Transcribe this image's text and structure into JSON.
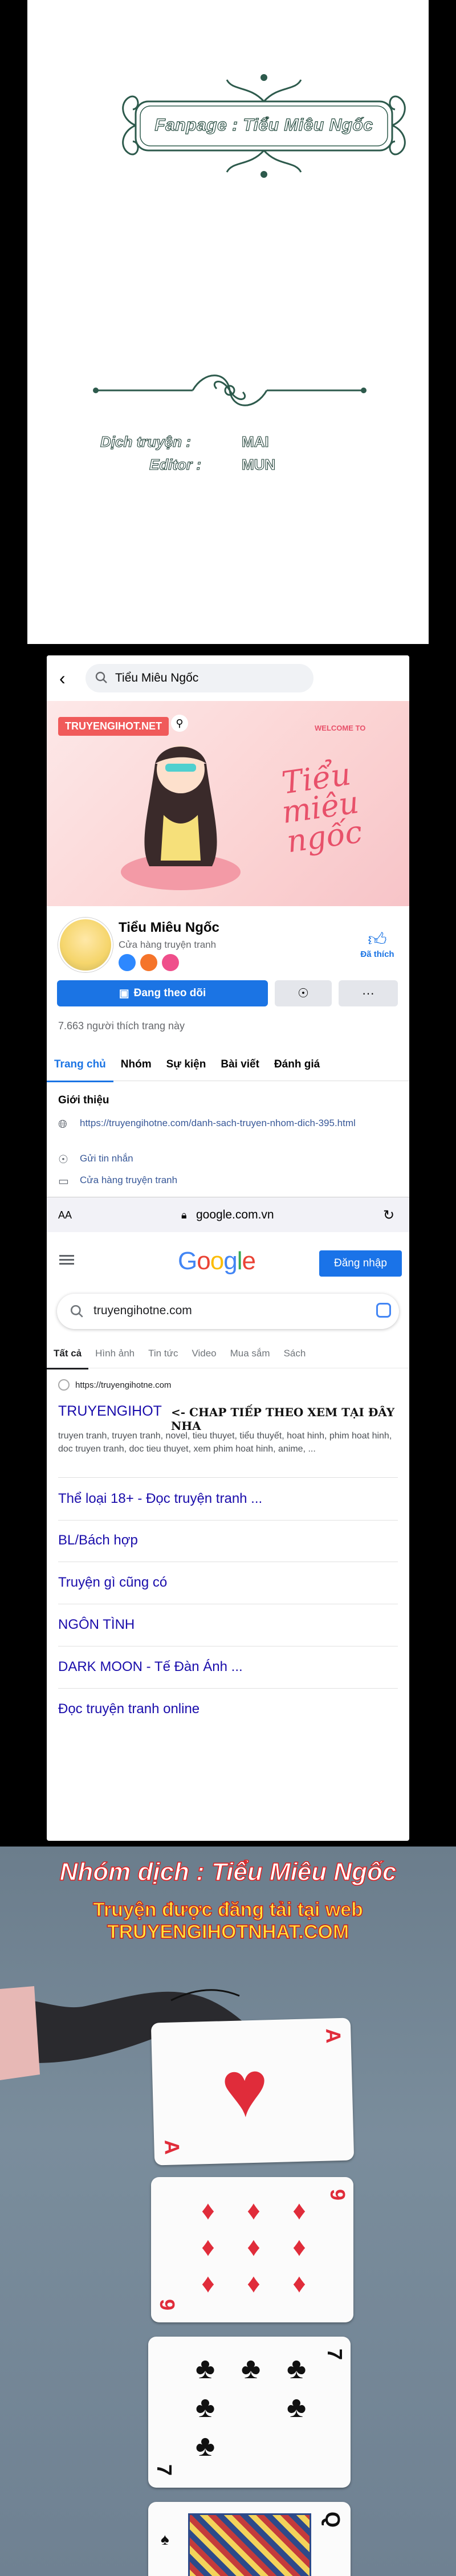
{
  "credits": {
    "fanpage": "Fanpage : Tiểu Miêu Ngốc",
    "translator_label": "Dịch truyện :",
    "translator_value": "MAI",
    "editor_label": "Editor :",
    "editor_value": "MUN"
  },
  "facebook": {
    "search_text": "Tiểu Miêu Ngốc",
    "cover_badge": "TRUYENGIHOT.NET",
    "cover_welcome": "WELCOME TO",
    "cover_title": "Tiểu miêu ngốc",
    "page_name": "Tiểu Miêu Ngốc",
    "page_category": "Cửa hàng truyện tranh",
    "like_label": "Đã thích",
    "follow_label": "Đang theo dõi",
    "more_label": "···",
    "likes_count": "7.663 người thích trang này",
    "tabs": [
      "Trang chủ",
      "Nhóm",
      "Sự kiện",
      "Bài viết",
      "Đánh giá"
    ],
    "intro_title": "Giới thiệu",
    "intro_link": "https://truyengihotne.com/danh-sach-truyen-nhom-dich-395.html",
    "intro_message": "Gửi tin nhắn",
    "intro_category": "Cửa hàng truyện tranh"
  },
  "browser": {
    "text_size": "AA",
    "url": "google.com.vn"
  },
  "google": {
    "logo": "Google",
    "signin": "Đăng nhập",
    "query": "truyengihotne.com",
    "tabs": [
      "Tất cả",
      "Hình ảnh",
      "Tin tức",
      "Video",
      "Mua sắm",
      "Sách"
    ],
    "result_url": "https://truyengihotne.com",
    "result_title": "TRUYENGIHOT",
    "result_note": "<- CHAP TIẾP THEO XEM TẠI ĐÂY NHA",
    "result_snippet": "truyen tranh, truyen tranh, novel, tieu thuyet, tiểu thuyết, hoat hinh, phim hoat hinh, doc truyen tranh, doc tieu thuyet, xem phim hoat hinh, anime, ...",
    "sitelinks": [
      "Thể loại 18+ - Đọc truyện tranh ...",
      "BL/Bách hợp",
      "Truyện gì cũng có",
      "NGÔN TÌNH",
      "DARK MOON - Tế Đàn Ánh ...",
      "Đọc truyện tranh online"
    ]
  },
  "manga": {
    "group": "Nhóm dịch : Tiểu Miêu Ngốc",
    "source": "Truyện được đăng tải tại web TRUYENGIHOTNHAT.COM",
    "cards": [
      {
        "rank": "A",
        "suit": "♥"
      },
      {
        "rank": "9",
        "suit": "♦"
      },
      {
        "rank": "7",
        "suit": "♣"
      },
      {
        "rank": "Q",
        "suit": "♠"
      }
    ]
  },
  "colors": {
    "fb_blue": "#1b74e4",
    "google_link": "#1a0dab",
    "banner_red": "#e02020",
    "banner_yellow": "#ffe43b"
  }
}
